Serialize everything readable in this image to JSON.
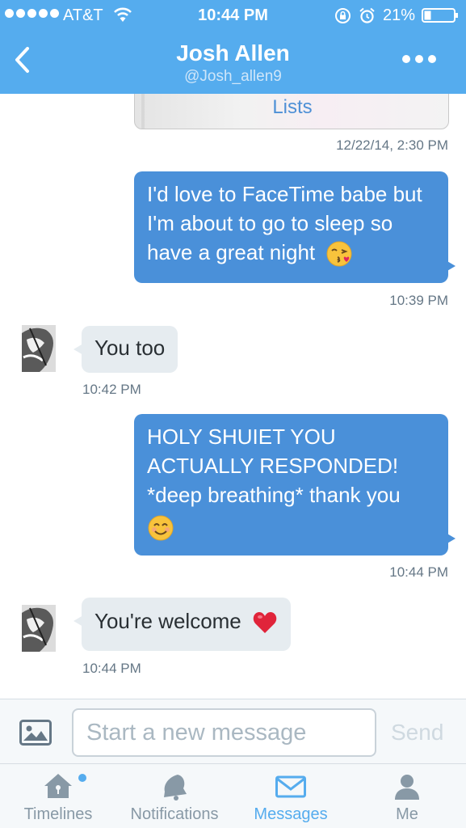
{
  "status": {
    "carrier": "AT&T",
    "time": "10:44 PM",
    "battery": "21%",
    "signal_bars": 5
  },
  "nav": {
    "title": "Josh Allen",
    "subtitle": "@Josh_allen9"
  },
  "messages": {
    "card_label": "Lists",
    "card_time": "12/22/14, 2:30 PM",
    "m1_text": "I'd love to FaceTime babe but I'm about to go to sleep so have a great night",
    "m1_emoji": "kissing-face-emoji",
    "m1_time": "10:39 PM",
    "m2_text": "You too",
    "m2_time": "10:42 PM",
    "m3_text": "HOLY SHUIET YOU ACTUALLY RESPONDED! *deep breathing* thank you",
    "m3_emoji": "smiling-face-emoji",
    "m3_time": "10:44 PM",
    "m4_text": "You're welcome",
    "m4_emoji": "red-heart-emoji",
    "m4_time": "10:44 PM"
  },
  "composer": {
    "placeholder": "Start a new message",
    "send_label": "Send"
  },
  "tabs": [
    {
      "label": "Timelines",
      "icon": "home-icon"
    },
    {
      "label": "Notifications",
      "icon": "bell-icon"
    },
    {
      "label": "Messages",
      "icon": "envelope-icon"
    },
    {
      "label": "Me",
      "icon": "person-icon"
    }
  ],
  "colors": {
    "brand": "#55acee",
    "outgoing_bubble": "#4a90d9",
    "incoming_bubble": "#e6ecf0",
    "inactive_tab": "#8899a6"
  }
}
